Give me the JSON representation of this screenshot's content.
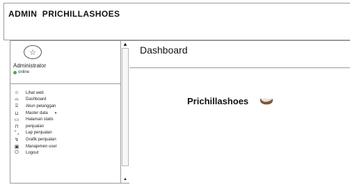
{
  "header": {
    "brand": "ADMIN  PRICHILLASHOES"
  },
  "user_panel": {
    "avatar_icon": "user-avatar-icon",
    "name": "Administrator",
    "status": "online",
    "status_color": "#3bb34a"
  },
  "menu": {
    "items": [
      {
        "icon": "web-icon",
        "label": "Lihat web"
      },
      {
        "icon": "dashboard-icon",
        "label": "Dashboard"
      },
      {
        "icon": "customer-icon",
        "label": "Akun pelanggan"
      },
      {
        "icon": "master-data-icon",
        "label": "Master data",
        "has_caret": "▾"
      },
      {
        "icon": "static-page-icon",
        "label": "Halaman statis"
      },
      {
        "icon": "sales-icon",
        "label": "penjualan"
      },
      {
        "icon": "report-icon",
        "label": "Lap penjualan"
      },
      {
        "icon": "chart-icon",
        "label": "Grafik penjualan"
      },
      {
        "icon": "user-manage-icon",
        "label": "Manajemen user"
      },
      {
        "icon": "logout-icon",
        "label": "Logout"
      }
    ]
  },
  "content": {
    "title": "Dashboard",
    "welcome": "Prichillashoes",
    "logo_icon": "shoe-icon"
  }
}
